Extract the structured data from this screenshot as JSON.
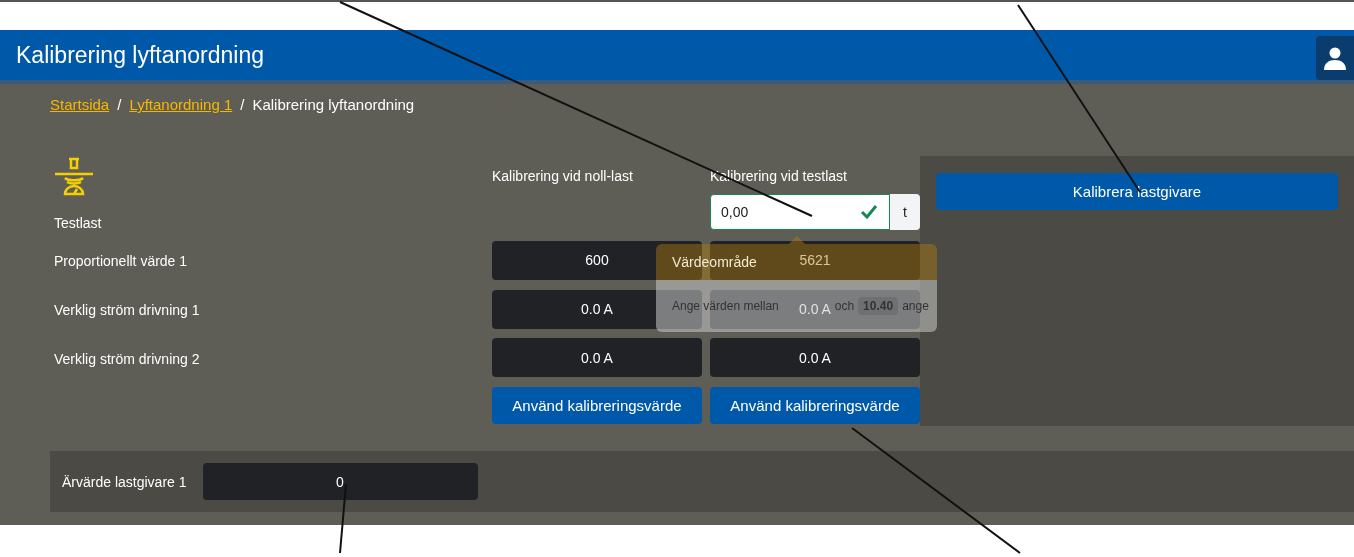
{
  "header": {
    "title": "Kalibrering lyftanordning"
  },
  "breadcrumb": [
    {
      "label": "Startsida",
      "kind": "link"
    },
    {
      "label": "/",
      "kind": "separator"
    },
    {
      "label": "Lyftanordning 1",
      "kind": "link"
    },
    {
      "label": "/",
      "kind": "separator"
    },
    {
      "label": "Kalibrering lyftanordning",
      "kind": "current"
    }
  ],
  "calibration": {
    "test_label": "Testlast",
    "columns": [
      "Kalibrering vid noll-last",
      "Kalibrering vid testlast"
    ],
    "test_load_input": {
      "value": "0,00",
      "valid": true,
      "unit": "t"
    },
    "rows": [
      {
        "label": "Proportionellt värde 1",
        "values": [
          "600",
          "5621"
        ]
      },
      {
        "label": "Verklig ström drivning 1",
        "values": [
          "0.0 A",
          "0.0 A"
        ]
      },
      {
        "label": "Verklig ström drivning 2",
        "values": [
          "0.0 A",
          "0.0 A"
        ]
      }
    ],
    "buttons": [
      "Använd kalibreringsvärde",
      "Använd kalibreringsvärde"
    ]
  },
  "tooltip": {
    "title": "Värdeområde",
    "text_before": "Ange värden mellan",
    "text_middle": "och",
    "max": "10.40",
    "text_after": "ange"
  },
  "side_panel": {
    "button": "Kalibrera lastgivare"
  },
  "actual_value": {
    "label": "Ärvärde lastgivare 1",
    "value": "0"
  }
}
